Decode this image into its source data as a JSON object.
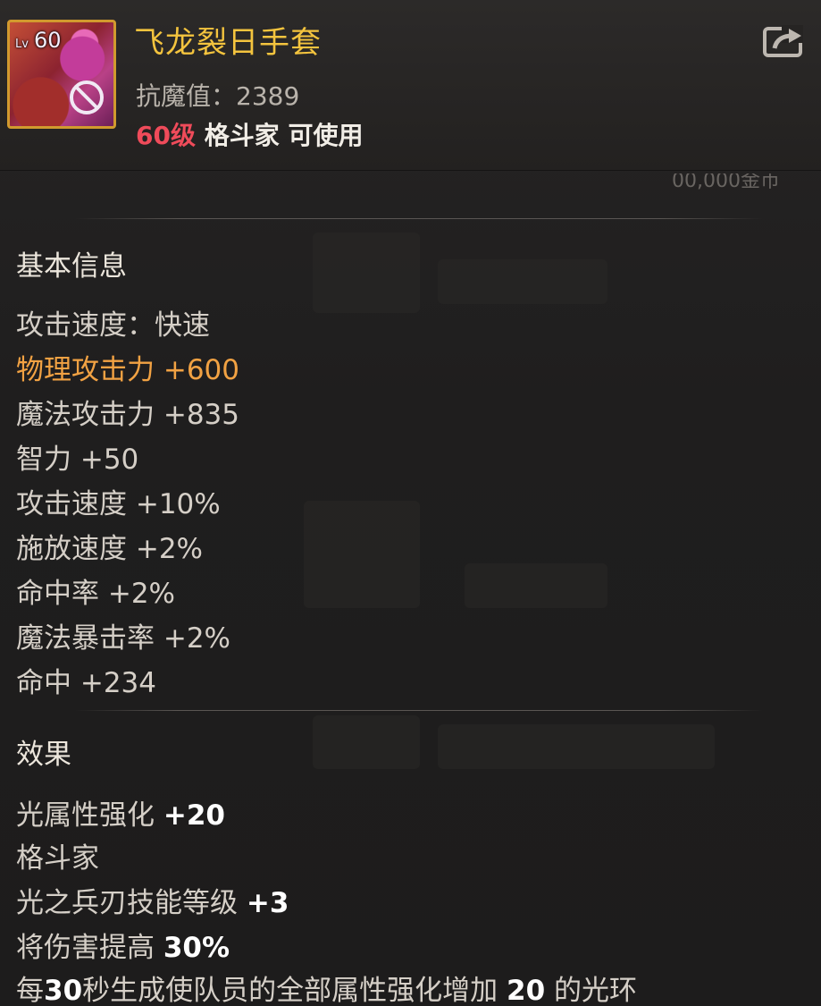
{
  "item": {
    "name": "飞龙裂日手套",
    "level_badge_prefix": "Lv",
    "level_badge": "60",
    "anti_magic": "抗魔值：2389",
    "requirement_level": "60级",
    "requirement_text": "格斗家 可使用",
    "faded_price": "00,000金币"
  },
  "basic_info": {
    "title": "基本信息",
    "attack_speed_type": "攻击速度：快速",
    "physical_attack": "物理攻击力 +600",
    "magic_attack": "魔法攻击力 +835",
    "intelligence": "智力 +50",
    "attack_speed": "攻击速度 +10%",
    "cast_speed": "施放速度 +2%",
    "hit_rate": "命中率 +2%",
    "magic_crit": "魔法暴击率 +2%",
    "accuracy": "命中 +234"
  },
  "effects": {
    "title": "效果",
    "light_prefix": "光属性强化 ",
    "light_value": "+20",
    "class_name": "格斗家",
    "skill_prefix": "光之兵刃技能等级 ",
    "skill_value": "+3",
    "damage_prefix": "将伤害提高 ",
    "damage_value": "30%",
    "aura_part1": "每",
    "aura_num1": "30",
    "aura_part2": "秒生成使队员的全部属性强化增加 ",
    "aura_num2": "20",
    "aura_part3": " 的光环"
  },
  "icons": {
    "share": "share-icon",
    "no_trade": "no-trade-icon"
  },
  "colors": {
    "title": "#f4c43e",
    "level_req": "#ef4b5a",
    "highlight_stat": "#f2a243",
    "icon_border": "#d19a2e"
  }
}
